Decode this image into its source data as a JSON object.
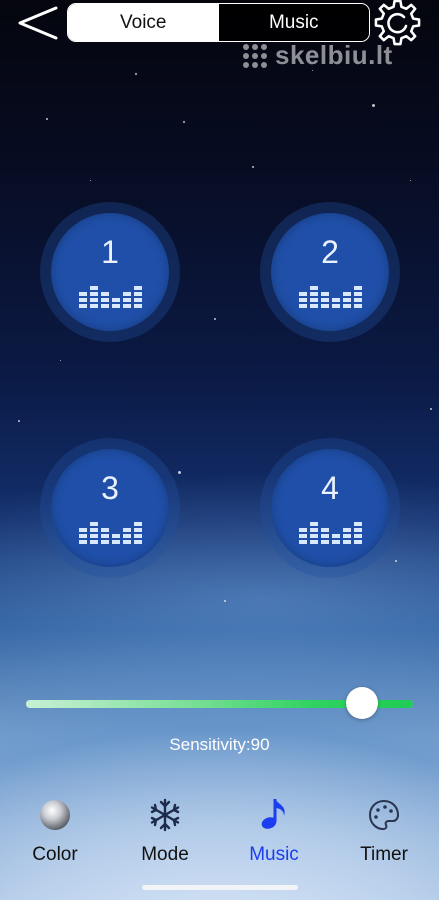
{
  "header": {
    "back_icon": "chevron-left-icon",
    "tabs": [
      {
        "label": "Voice",
        "active": true
      },
      {
        "label": "Music",
        "active": false
      }
    ],
    "settings_icon": "gear-icon",
    "watermark": "skelbiu.lt"
  },
  "pads": [
    {
      "label": "1",
      "icon": "equalizer-icon"
    },
    {
      "label": "2",
      "icon": "equalizer-icon"
    },
    {
      "label": "3",
      "icon": "equalizer-icon"
    },
    {
      "label": "4",
      "icon": "equalizer-icon"
    }
  ],
  "sensitivity": {
    "text": "Sensitivity:90",
    "value": 90,
    "max": 100
  },
  "nav": [
    {
      "label": "Color",
      "icon": "color-ball-icon",
      "active": false
    },
    {
      "label": "Mode",
      "icon": "snowflake-icon",
      "active": false
    },
    {
      "label": "Music",
      "icon": "music-note-icon",
      "active": true
    },
    {
      "label": "Timer",
      "icon": "palette-icon",
      "active": false
    }
  ],
  "colors": {
    "pad": "#1f4fa8",
    "slider_fill": "#1fcc54",
    "nav_active": "#1a3ef0"
  }
}
